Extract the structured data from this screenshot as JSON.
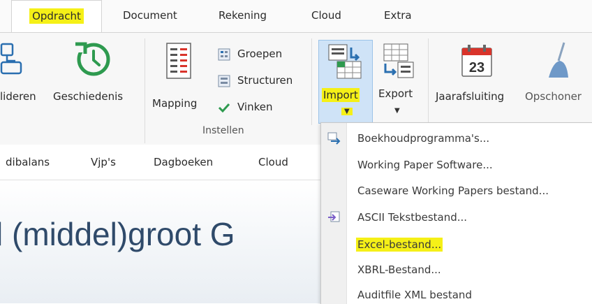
{
  "tabs": [
    {
      "label": "Opdracht",
      "active": true,
      "highlighted": true
    },
    {
      "label": "Document"
    },
    {
      "label": "Rekening"
    },
    {
      "label": "Cloud"
    },
    {
      "label": "Extra"
    }
  ],
  "ribbon": {
    "buttons": {
      "valideren": "lideren",
      "geschiedenis": "Geschiedenis",
      "mapping": "Mapping",
      "groepen": "Groepen",
      "structuren": "Structuren",
      "vinken": "Vinken",
      "import": "Import",
      "export": "Export",
      "jaarafsluiting": "Jaarafsluiting",
      "jaarafsluiting_day": "23",
      "opschonen": "Opschoner"
    },
    "group_label": "Instellen"
  },
  "subtabs": [
    "dibalans",
    "Vjp's",
    "Dagboeken",
    "Cloud"
  ],
  "page": {
    "title_fragment": "l (middel)groot G"
  },
  "import_menu": {
    "items": [
      {
        "label": "Boekhoudprogramma's...",
        "icon": "import-program-icon"
      },
      {
        "label": "Working Paper Software..."
      },
      {
        "label": "Caseware Working Papers bestand..."
      },
      {
        "label": "ASCII Tekstbestand...",
        "icon": "import-text-icon"
      },
      {
        "label": "Excel-bestand...",
        "highlighted": true
      },
      {
        "label": "XBRL-Bestand..."
      },
      {
        "label": "Auditfile XML bestand"
      }
    ]
  },
  "colors": {
    "highlight": "#f5f017",
    "accent_blue": "#2a6fb0",
    "green": "#2e9a4f",
    "red": "#d9342b"
  }
}
